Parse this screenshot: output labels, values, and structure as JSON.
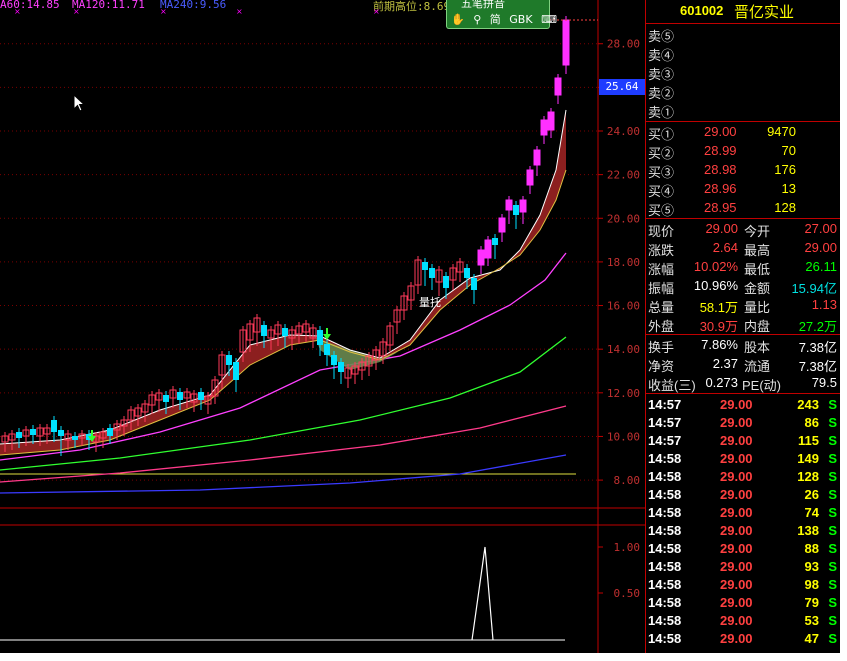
{
  "ma_labels": {
    "ma60": "A60:14.85",
    "ma120": "MA120:11.71",
    "ma240": "MA240:9.56",
    "prev_high": "前期高位:8.69"
  },
  "colors": {
    "up": "#ff3050",
    "down": "#00e0ff",
    "ma60": "#ff40ff",
    "ma120": "#ff40ff",
    "ma240": "#4040ff"
  },
  "toolbar": {
    "title": "五笔拼音",
    "search_icon": "search-icon",
    "simp_label": "简",
    "gbk_label": "GBK",
    "hand_icon": "hand-icon",
    "keyboard_icon": "keyboard-icon"
  },
  "chart": {
    "price_axis": [
      "28.00",
      "26.00",
      "24.00",
      "22.00",
      "20.00",
      "18.00",
      "16.00",
      "14.00",
      "12.00",
      "10.00",
      "8.00"
    ],
    "current_price_tag": "25.64",
    "annotation": "量托",
    "volume_axis": [
      "1.00",
      "0.50"
    ]
  },
  "chart_data": {
    "type": "line",
    "title": "",
    "series": [
      {
        "name": "MA60",
        "values": []
      },
      {
        "name": "MA120",
        "values": []
      },
      {
        "name": "MA240",
        "values": []
      }
    ],
    "ylim": [
      7.5,
      29.5
    ],
    "y_ticks": [
      8,
      10,
      12,
      14,
      16,
      18,
      20,
      22,
      24,
      26,
      28
    ],
    "last_close": 29.0
  },
  "stock": {
    "code": "601002",
    "name": "晋亿实业"
  },
  "order_book": {
    "sell": [
      {
        "label": "卖⑤",
        "price": "",
        "volume": ""
      },
      {
        "label": "卖④",
        "price": "",
        "volume": ""
      },
      {
        "label": "卖③",
        "price": "",
        "volume": ""
      },
      {
        "label": "卖②",
        "price": "",
        "volume": ""
      },
      {
        "label": "卖①",
        "price": "",
        "volume": ""
      }
    ],
    "buy": [
      {
        "label": "买①",
        "price": "29.00",
        "volume": "9470"
      },
      {
        "label": "买②",
        "price": "28.99",
        "volume": "70"
      },
      {
        "label": "买③",
        "price": "28.98",
        "volume": "176"
      },
      {
        "label": "买④",
        "price": "28.96",
        "volume": "13"
      },
      {
        "label": "买⑤",
        "price": "28.95",
        "volume": "128"
      }
    ]
  },
  "quote": [
    {
      "l1": "现价",
      "v1": "29.00",
      "l2": "今开",
      "v2": "27.00"
    },
    {
      "l1": "涨跌",
      "v1": "2.64",
      "l2": "最高",
      "v2": "29.00"
    },
    {
      "l1": "涨幅",
      "v1": "10.02%",
      "l2": "最低",
      "v2": "26.11"
    },
    {
      "l1": "振幅",
      "v1": "10.96%",
      "l2": "金额",
      "v2": "15.94亿"
    },
    {
      "l1": "总量",
      "v1": "58.1万",
      "l2": "量比",
      "v2": "1.13"
    },
    {
      "l1": "外盘",
      "v1": "30.9万",
      "l2": "内盘",
      "v2": "27.2万"
    }
  ],
  "fundamentals": [
    {
      "l1": "换手",
      "v1": "7.86%",
      "l2": "股本",
      "v2": "7.38亿"
    },
    {
      "l1": "净资",
      "v1": "2.37",
      "l2": "流通",
      "v2": "7.38亿"
    },
    {
      "l1": "收益(三)",
      "v1": "0.273",
      "l2": "PE(动)",
      "v2": "79.5"
    }
  ],
  "ticks": [
    {
      "time": "14:57",
      "price": "29.00",
      "vol": "243",
      "side": "S"
    },
    {
      "time": "14:57",
      "price": "29.00",
      "vol": "86",
      "side": "S"
    },
    {
      "time": "14:57",
      "price": "29.00",
      "vol": "115",
      "side": "S"
    },
    {
      "time": "14:58",
      "price": "29.00",
      "vol": "149",
      "side": "S"
    },
    {
      "time": "14:58",
      "price": "29.00",
      "vol": "128",
      "side": "S"
    },
    {
      "time": "14:58",
      "price": "29.00",
      "vol": "26",
      "side": "S"
    },
    {
      "time": "14:58",
      "price": "29.00",
      "vol": "74",
      "side": "S"
    },
    {
      "time": "14:58",
      "price": "29.00",
      "vol": "138",
      "side": "S"
    },
    {
      "time": "14:58",
      "price": "29.00",
      "vol": "88",
      "side": "S"
    },
    {
      "time": "14:58",
      "price": "29.00",
      "vol": "93",
      "side": "S"
    },
    {
      "time": "14:58",
      "price": "29.00",
      "vol": "98",
      "side": "S"
    },
    {
      "time": "14:58",
      "price": "29.00",
      "vol": "79",
      "side": "S"
    },
    {
      "time": "14:58",
      "price": "29.00",
      "vol": "53",
      "side": "S"
    },
    {
      "time": "14:58",
      "price": "29.00",
      "vol": "47",
      "side": "S"
    }
  ]
}
